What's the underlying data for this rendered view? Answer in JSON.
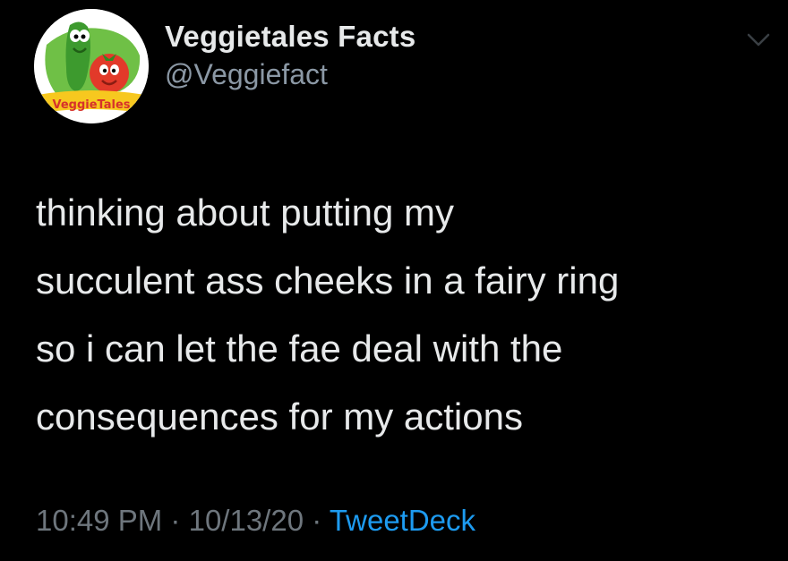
{
  "account": {
    "display_name": "Veggietales Facts",
    "handle": "@Veggiefact",
    "avatar_logo_text": "VeggieTales"
  },
  "tweet": {
    "lines": [
      "thinking about putting my",
      "succulent ass cheeks in a fairy ring",
      "so i can let the fae deal with the",
      "consequences for my actions"
    ],
    "time": "10:49 PM",
    "date": "10/13/20",
    "separator": "·",
    "source": "TweetDeck"
  },
  "colors": {
    "background": "#000000",
    "text": "#e7e9ea",
    "muted": "#6e767d",
    "link": "#1d9bf0"
  },
  "icons": {
    "menu": "chevron-down-icon"
  }
}
